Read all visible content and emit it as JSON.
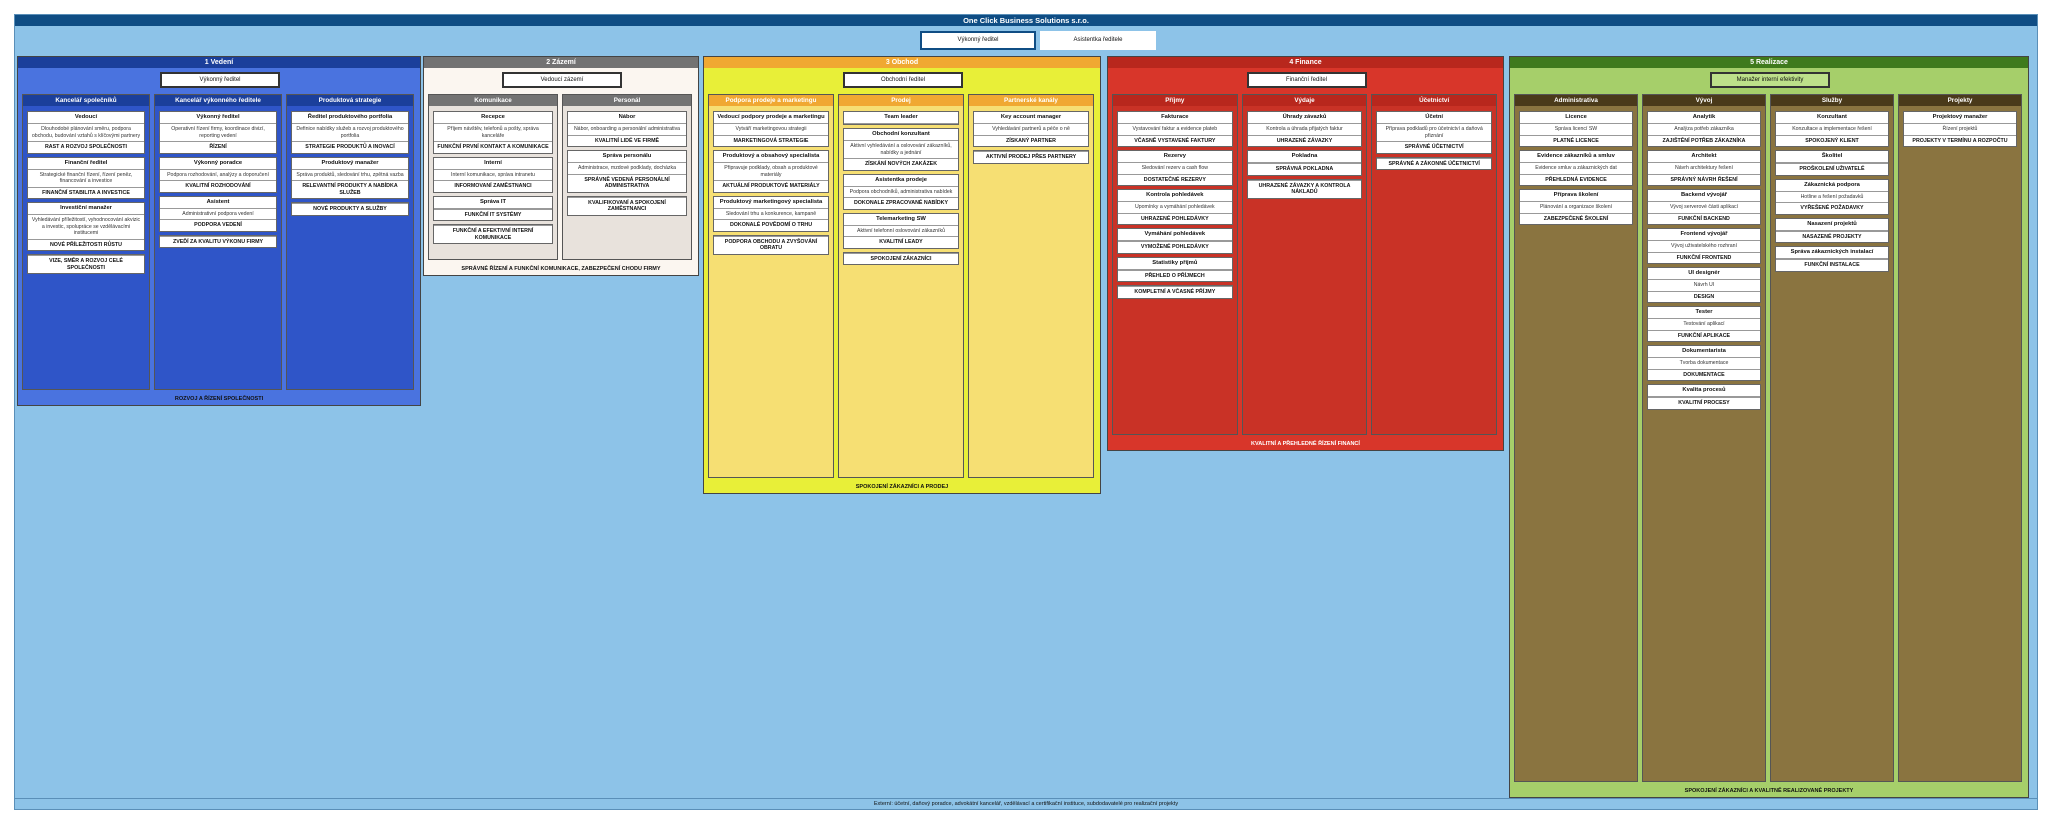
{
  "title": "One Click Business Solutions s.r.o.",
  "top": {
    "ceo": "Výkonný ředitel",
    "assistant": "Asistentka ředitele"
  },
  "external": "Externí: účetní, daňový poradce, advokátní kancelář, vzdělávací a certifikační instituce, subdodavatelé pro realizační projekty",
  "divisions": [
    {
      "name": "1 Vedení",
      "manager": "Výkonný ředitel",
      "footer": "ROZVOJ A ŘÍZENÍ SPOLEČNOSTI",
      "color": "#3f64d8",
      "cols": [
        {
          "name": "Kancelář společníků",
          "units": [
            {
              "h": "Vedoucí",
              "t": "Dlouhodobé plánování směru, podpora obchodu, budování vztahů s klíčovými partnery",
              "b": "RAST A ROZVOJ SPOLEČNOSTI"
            },
            {
              "h": "Finanční ředitel",
              "t": "Strategické finanční řízení, řízení peněz, financování a investice",
              "b": "FINANČNÍ STABILITA A INVESTICE"
            },
            {
              "h": "Investiční manažer",
              "t": "Vyhledávání příležitostí, vyhodnocování akvizic a investic, spolupráce se vzdělávacími institucemi",
              "b": "NOVÉ PŘÍLEŽITOSTI RŮSTU"
            },
            {
              "h": "",
              "t": "",
              "b": "VIZE, SMĚR A ROZVOJ CELÉ SPOLEČNOSTI"
            }
          ]
        },
        {
          "name": "Kancelář výkonného ředitele",
          "units": [
            {
              "h": "Výkonný ředitel",
              "t": "Operativní řízení firmy, koordinace divizí, reporting vedení",
              "b": "ŘÍZENÍ"
            },
            {
              "h": "Výkonný poradce",
              "t": "Podpora rozhodování, analýzy a doporučení",
              "b": "KVALITNÍ ROZHODOVÁNÍ"
            },
            {
              "h": "Asistent",
              "t": "Administrativní podpora vedení",
              "b": "PODPORA VEDENÍ"
            },
            {
              "h": "",
              "t": "",
              "b": "ZVEĎÍ ZA KVALITU VÝKONU FIRMY"
            }
          ]
        },
        {
          "name": "Produktová strategie",
          "units": [
            {
              "h": "Ředitel produktového portfolia",
              "t": "Definice nabídky služeb a rozvoj produktového portfolia",
              "b": "STRATEGIE PRODUKTŮ A INOVACÍ"
            },
            {
              "h": "Produktový manažer",
              "t": "Správa produktů, sledování trhu, zpětná vazba",
              "b": "RELEVANTNÍ PRODUKTY A NABÍDKA SLUŽEB"
            },
            {
              "h": "",
              "t": "",
              "b": "NOVÉ PRODUKTY A SLUŽBY"
            }
          ]
        }
      ]
    },
    {
      "name": "2 Zázemí",
      "manager": "Vedoucí zázemí",
      "footer": "SPRÁVNÉ ŘÍZENÍ A FUNKČNÍ KOMUNIKACE, ZABEZPEČENÍ CHODU FIRMY",
      "color": "#737373",
      "cols": [
        {
          "name": "Komunikace",
          "units": [
            {
              "h": "Recepce",
              "t": "Příjem návštěv, telefonů a pošty, správa kanceláře",
              "b": "FUNKČNÍ PRVNÍ KONTAKT A KOMUNIKACE"
            },
            {
              "h": "Interní",
              "t": "Interní komunikace, správa intranetu",
              "b": "INFORMOVANÍ ZAMĚSTNANCI"
            },
            {
              "h": "Správa IT",
              "t": "",
              "b": "FUNKČNÍ IT SYSTÉMY"
            },
            {
              "h": "",
              "t": "",
              "b": "FUNKČNÍ A EFEKTIVNÍ INTERNÍ KOMUNIKACE"
            }
          ]
        },
        {
          "name": "Personál",
          "units": [
            {
              "h": "Nábor",
              "t": "Nábor, onboarding a personální administrativa",
              "b": "KVALITNÍ LIDÉ VE FIRMĚ"
            },
            {
              "h": "Správa personálu",
              "t": "Administrace, mzdové podklady, docházka",
              "b": "SPRÁVNĚ VEDENÁ PERSONÁLNÍ ADMINISTRATIVA"
            },
            {
              "h": "",
              "t": "",
              "b": "KVALIFIKOVANÍ A SPOKOJENÍ ZAMĚSTNANCI"
            }
          ]
        }
      ]
    },
    {
      "name": "3 Obchod",
      "manager": "Obchodní ředitel",
      "footer": "SPOKOJENÍ ZÁKAZNÍCI A PRODEJ",
      "color": "#e6e63c",
      "cols": [
        {
          "name": "Podpora prodeje a marketingu",
          "units": [
            {
              "h": "Vedoucí podpory prodeje a marketingu",
              "t": "Vytváří marketingovou strategii",
              "b": "MARKETINGOVÁ STRATEGIE"
            },
            {
              "h": "Produktový a obsahový specialista",
              "t": "Připravuje podklady, obsah a produktové materiály",
              "b": "AKTUÁLNÍ PRODUKTOVÉ MATERIÁLY"
            },
            {
              "h": "Produktový marketingový specialista",
              "t": "Sledování trhu a konkurence, kampaně",
              "b": "DOKONALÉ POVĚDOMÍ O TRHU"
            },
            {
              "h": "",
              "t": "",
              "b": "PODPORA OBCHODU A ZVYŠOVÁNÍ OBRATU"
            }
          ]
        },
        {
          "name": "Prodej",
          "units": [
            {
              "h": "Team leader",
              "t": "",
              "b": ""
            },
            {
              "h": "Obchodní konzultant",
              "t": "Aktivní vyhledávání a oslovování zákazníků, nabídky a jednání",
              "b": "ZÍSKÁNÍ NOVÝCH ZAKÁZEK"
            },
            {
              "h": "Asistentka prodeje",
              "t": "Podpora obchodníků, administrativa nabídek",
              "b": "DOKONALE ZPRACOVANÉ NABÍDKY"
            },
            {
              "h": "Telemarketing SW",
              "t": "Aktivní telefonní oslovování zákazníků",
              "b": "KVALITNÍ LEADY"
            },
            {
              "h": "",
              "t": "",
              "b": "SPOKOJENÍ ZÁKAZNÍCI"
            }
          ]
        },
        {
          "name": "Partnerské kanály",
          "units": [
            {
              "h": "Key account manager",
              "t": "Vyhledávání partnerů a péče o ně",
              "b": "ZÍSKANÝ PARTNER"
            },
            {
              "h": "",
              "t": "",
              "b": "AKTIVNÍ PRODEJ PŘES PARTNERY"
            }
          ]
        }
      ]
    },
    {
      "name": "4 Finance",
      "manager": "Finanční ředitel",
      "footer": "KVALITNÍ A PŘEHLEDNÉ ŘÍZENÍ FINANCÍ",
      "color": "#d8362a",
      "cols": [
        {
          "name": "Příjmy",
          "units": [
            {
              "h": "Fakturace",
              "t": "Vystavování faktur a evidence plateb",
              "b": "VČASNĚ VYSTAVENÉ FAKTURY"
            },
            {
              "h": "Rezervy",
              "t": "Sledování rezerv a cash flow",
              "b": "DOSTATEČNÉ REZERVY"
            },
            {
              "h": "Kontrola pohledávek",
              "t": "Upomínky a vymáhání pohledávek",
              "b": "UHRAZENÉ POHLEDÁVKY"
            },
            {
              "h": "Vymáhání pohledávek",
              "t": "",
              "b": "VYMOŽENÉ POHLEDÁVKY"
            },
            {
              "h": "Statistiky příjmů",
              "t": "",
              "b": "PŘEHLED O PŘÍJMECH"
            },
            {
              "h": "",
              "t": "",
              "b": "KOMPLETNÍ A VČASNÉ PŘÍJMY"
            }
          ]
        },
        {
          "name": "Výdaje",
          "units": [
            {
              "h": "Úhrady závazků",
              "t": "Kontrola a úhrada přijatých faktur",
              "b": "UHRAZENÉ ZÁVAZKY"
            },
            {
              "h": "Pokladna",
              "t": "",
              "b": "SPRÁVNÁ POKLADNA"
            },
            {
              "h": "",
              "t": "",
              "b": "UHRAZENÉ ZÁVAZKY A KONTROLA NÁKLADŮ"
            }
          ]
        },
        {
          "name": "Účetnictví",
          "units": [
            {
              "h": "Účetní",
              "t": "Příprava podkladů pro účetnictví a daňová přiznání",
              "b": "SPRÁVNÉ ÚČETNICTVÍ"
            },
            {
              "h": "",
              "t": "",
              "b": "SPRÁVNÉ A ZÁKONNÉ ÚČETNICTVÍ"
            }
          ]
        }
      ]
    },
    {
      "name": "5 Realizace",
      "manager": "Manažer interní efektivity",
      "footer": "SPOKOJENÍ ZÁKAZNÍCI A KVALITNĚ REALIZOVANÉ PROJEKTY",
      "color": "#8bbd3c",
      "cols": [
        {
          "name": "Administrativa",
          "units": [
            {
              "h": "Licence",
              "t": "Správa licencí SW",
              "b": "PLATNÉ LICENCE"
            },
            {
              "h": "Evidence zákazníků a smluv",
              "t": "Evidence smluv a zákaznických dat",
              "b": "PŘEHLEDNÁ EVIDENCE"
            },
            {
              "h": "Příprava školení",
              "t": "Plánování a organizace školení",
              "b": "ZABEZPEČENÉ ŠKOLENÍ"
            }
          ]
        },
        {
          "name": "Vývoj",
          "units": [
            {
              "h": "Analytik",
              "t": "Analýza potřeb zákazníka",
              "b": "ZAJIŠTĚNÍ POTŘEB ZÁKAZNÍKA"
            },
            {
              "h": "Architekt",
              "t": "Návrh architektury řešení",
              "b": "SPRÁVNÝ NÁVRH ŘEŠENÍ"
            },
            {
              "h": "Backend vývojář",
              "t": "Vývoj serverové části aplikací",
              "b": "FUNKČNÍ BACKEND"
            },
            {
              "h": "Frontend vývojář",
              "t": "Vývoj uživatelského rozhraní",
              "b": "FUNKČNÍ FRONTEND"
            },
            {
              "h": "UI designér",
              "t": "Návrh UI",
              "b": "DESIGN"
            },
            {
              "h": "Tester",
              "t": "Testování aplikací",
              "b": "FUNKČNÍ APLIKACE"
            },
            {
              "h": "Dokumentarista",
              "t": "Tvorba dokumentace",
              "b": "DOKUMENTACE"
            },
            {
              "h": "Kvalita procesů",
              "t": "",
              "b": "KVALITNÍ PROCESY"
            }
          ]
        },
        {
          "name": "Služby",
          "units": [
            {
              "h": "Konzultant",
              "t": "Konzultace a implementace řešení",
              "b": "SPOKOJENÝ KLIENT"
            },
            {
              "h": "Školitel",
              "t": "",
              "b": "PROŠKOLENÍ UŽIVATELÉ"
            },
            {
              "h": "Zákaznická podpora",
              "t": "Hotline a řešení požadavků",
              "b": "VYŘEŠENÉ POŽADAVKY"
            },
            {
              "h": "Nasazení projektů",
              "t": "",
              "b": "NASAZENÉ PROJEKTY"
            },
            {
              "h": "Správa zákaznických instalací",
              "t": "",
              "b": "FUNKČNÍ INSTALACE"
            }
          ]
        },
        {
          "name": "Projekty",
          "units": [
            {
              "h": "Projektový manažer",
              "t": "Řízení projektů",
              "b": "PROJEKTY V TERMÍNU A ROZPOČTU"
            }
          ]
        }
      ]
    }
  ]
}
